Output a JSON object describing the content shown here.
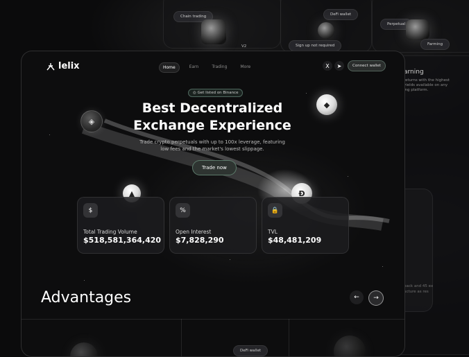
{
  "background": {
    "cards": {
      "chain_trading": "Chain trading",
      "v2": "V2",
      "defi_wallet": "DeFi wallet",
      "sign_up": "Sign up not required",
      "perpetual": "Perpetual",
      "farming": "Farming",
      "farming_title": "arning",
      "farming_desc": "returns with the highest yields available on any ing platform.",
      "bottom_defi_wallet": "DeFi wallet",
      "side_text_1": "back and 45 ex",
      "side_text_2": "ucture as res"
    }
  },
  "header": {
    "logo": "lelix",
    "nav": [
      "Home",
      "Earn",
      "Trading",
      "More"
    ],
    "social": {
      "x": "X",
      "telegram": "➤"
    },
    "connect_label": "Connect wallet"
  },
  "hero": {
    "badge": "Get listed on Binance",
    "title_line1": "Best Decentralized",
    "title_line2": "Exchange Experience",
    "subtitle_line1": "Trade crypto perpetuals with up to 100x leverage, featuring",
    "subtitle_line2": "low fees and the market's lowest slippage.",
    "cta": "Trade now"
  },
  "stats": [
    {
      "label": "Total Trading Volume",
      "value": "$518,581,364,420",
      "icon": "$"
    },
    {
      "label": "Open Interest",
      "value": "$7,828,290",
      "icon": "%"
    },
    {
      "label": "TVL",
      "value": "$48,481,209",
      "icon": "🔒"
    }
  ],
  "advantages": {
    "title": "Advantages",
    "prev": "←",
    "next": "→"
  },
  "coins": {
    "bnb": "◈",
    "eth": "◆",
    "other": "▲",
    "doge": "Ð"
  },
  "colors": {
    "background": "#0b0b0c",
    "frame": "#0d0d0e",
    "accent_border": "#96d2b4"
  }
}
